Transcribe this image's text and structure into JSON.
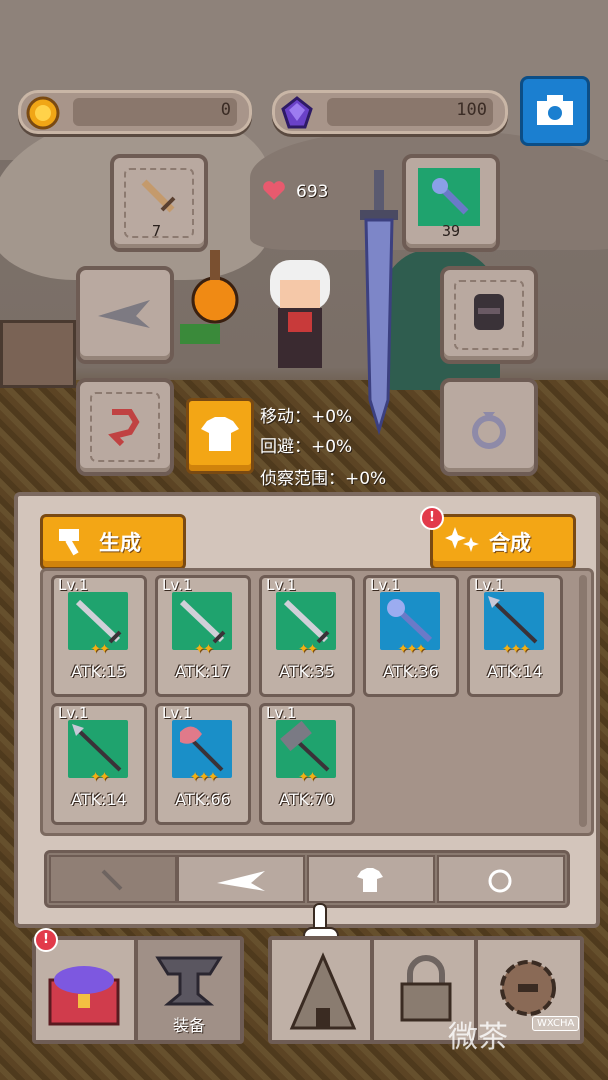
{
  "hud": {
    "gold": "0",
    "gems": "100",
    "hp": "693"
  },
  "equip_slots": {
    "weapon_left_count": "7",
    "weapon_right_count": "39"
  },
  "stats": {
    "move": "移动：+0%",
    "dodge": "回避：+0%",
    "scout": "侦察范围：+0%"
  },
  "panel": {
    "generate_label": "生成",
    "synth_label": "合成",
    "synth_badge": "!",
    "cards": [
      {
        "lv": "Lv.1",
        "atk": "ATK:15",
        "stars": "✦✦",
        "color": "#1fa36e",
        "icon": "sword-icon"
      },
      {
        "lv": "Lv.1",
        "atk": "ATK:17",
        "stars": "✦✦",
        "color": "#1fa36e",
        "icon": "sword-icon"
      },
      {
        "lv": "Lv.1",
        "atk": "ATK:35",
        "stars": "✦✦",
        "color": "#1fa36e",
        "icon": "sword-icon"
      },
      {
        "lv": "Lv.1",
        "atk": "ATK:36",
        "stars": "✦✦✦",
        "color": "#1a8fc8",
        "icon": "mace-icon"
      },
      {
        "lv": "Lv.1",
        "atk": "ATK:14",
        "stars": "✦✦✦",
        "color": "#1a8fc8",
        "icon": "spear-icon"
      },
      {
        "lv": "Lv.1",
        "atk": "ATK:14",
        "stars": "✦✦",
        "color": "#1fa36e",
        "icon": "spear-icon"
      },
      {
        "lv": "Lv.1",
        "atk": "ATK:66",
        "stars": "✦✦✦",
        "color": "#1a8fc8",
        "icon": "axe-icon"
      },
      {
        "lv": "Lv.1",
        "atk": "ATK:70",
        "stars": "✦✦",
        "color": "#1fa36e",
        "icon": "hammer-icon"
      }
    ]
  },
  "nav": {
    "equip_label": "装备",
    "chest_badge": "!"
  },
  "watermark": {
    "main": "微茶",
    "small": "WXCHA"
  },
  "colors": {
    "gold": "#f3a615",
    "blue": "#1b7fd0",
    "green_rarity": "#1fa36e",
    "blue_rarity": "#1a8fc8"
  }
}
